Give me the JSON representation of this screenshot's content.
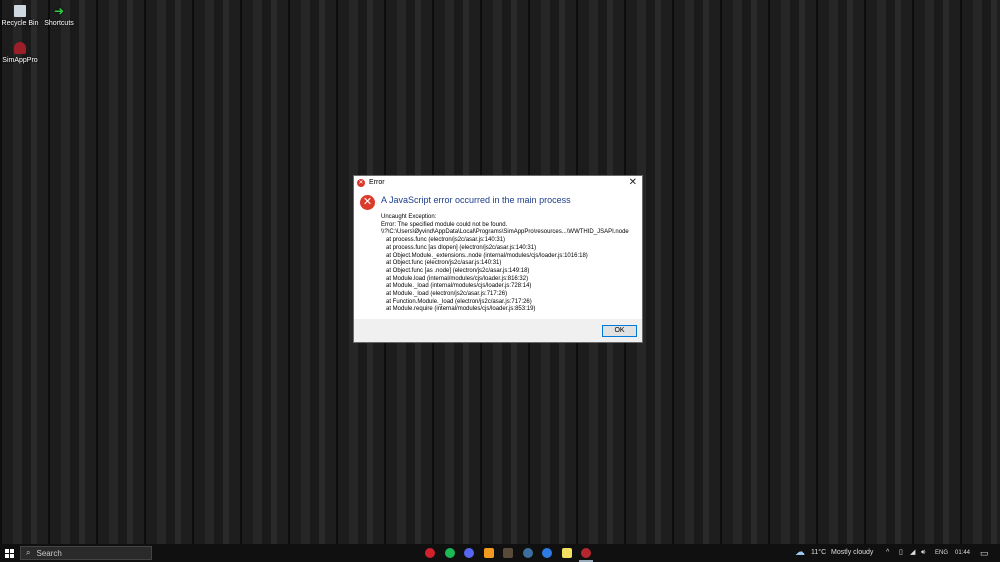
{
  "desktop": {
    "icons": [
      {
        "label": "Recycle Bin"
      },
      {
        "label": "Shortcuts"
      },
      {
        "label": "SimAppPro"
      }
    ]
  },
  "dialog": {
    "title": "Error",
    "heading": "A JavaScript error occurred in the main process",
    "lines": [
      "Uncaught Exception:",
      "Error: The specified module could not be found.",
      "\\\\?\\C:\\Users\\Øyvind\\AppData\\Local\\Programs\\SimAppPro\\resources...\\WWTHID_JSAPI.node"
    ],
    "stack": [
      "at process.func (electron/js2c/asar.js:140:31)",
      "at process.func [as dlopen] (electron/js2c/asar.js:140:31)",
      "at Object.Module._extensions..node (internal/modules/cjs/loader.js:1016:18)",
      "at Object.func (electron/js2c/asar.js:140:31)",
      "at Object.func [as .node] (electron/js2c/asar.js:149:18)",
      "at Module.load (internal/modules/cjs/loader.js:816:32)",
      "at Module._load (internal/modules/cjs/loader.js:728:14)",
      "at Module._load (electron/js2c/asar.js:717:26)",
      "at Function.Module._load (electron/js2c/asar.js:717:26)",
      "at Module.require (internal/modules/cjs/loader.js:853:19)"
    ],
    "ok_label": "OK",
    "close_glyph": "✕"
  },
  "taskbar": {
    "search_label": "Search",
    "weather_temp": "11°C",
    "weather_text": "Mostly cloudy",
    "language": "ENG",
    "time": "01:44",
    "apps": [
      {
        "name": "opera",
        "color": "#d0212d"
      },
      {
        "name": "spotify",
        "color": "#1db954"
      },
      {
        "name": "discord",
        "color": "#5865f2"
      },
      {
        "name": "app-orange",
        "color": "#f19a1f"
      },
      {
        "name": "app-dark",
        "color": "#5a4a3a"
      },
      {
        "name": "steam",
        "color": "#3d6f9e"
      },
      {
        "name": "app-arc",
        "color": "#2d7be5"
      },
      {
        "name": "app-g",
        "color": "#f3e060"
      },
      {
        "name": "simappro",
        "color": "#b3262e"
      }
    ]
  }
}
